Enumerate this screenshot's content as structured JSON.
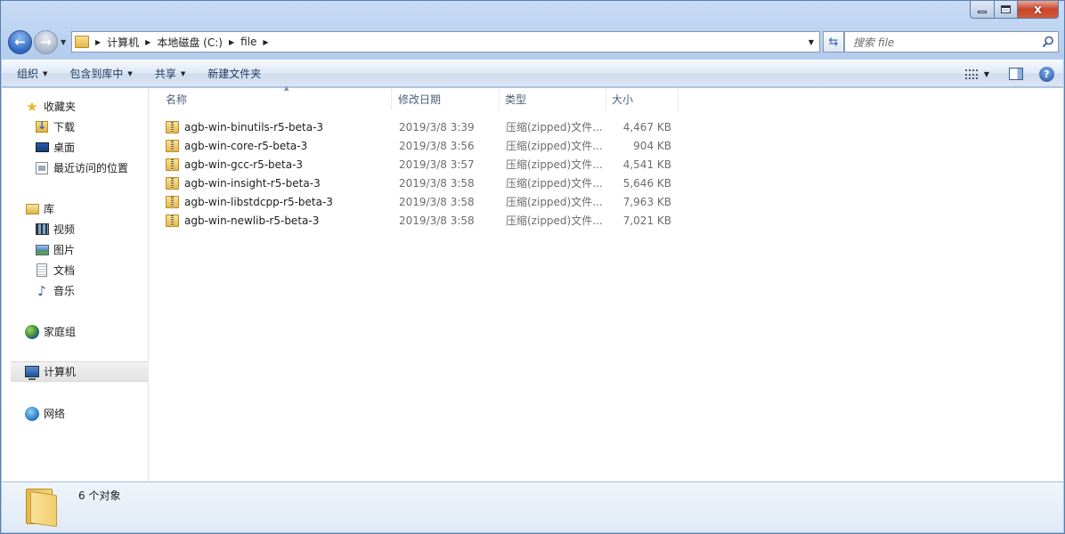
{
  "window": {
    "close_glyph": "x"
  },
  "address": {
    "crumbs": [
      "计算机",
      "本地磁盘 (C:)",
      "file"
    ]
  },
  "search": {
    "placeholder": "搜索 file"
  },
  "toolbar": {
    "organize": "组织",
    "include_in_library": "包含到库中",
    "share": "共享",
    "new_folder": "新建文件夹",
    "help": "?"
  },
  "sidebar": {
    "favorites": {
      "label": "收藏夹",
      "items": [
        {
          "label": "下载",
          "icon": "download-folder-icon"
        },
        {
          "label": "桌面",
          "icon": "desktop-icon"
        },
        {
          "label": "最近访问的位置",
          "icon": "recent-places-icon"
        }
      ]
    },
    "libraries": {
      "label": "库",
      "items": [
        {
          "label": "视频",
          "icon": "video-icon"
        },
        {
          "label": "图片",
          "icon": "pictures-icon"
        },
        {
          "label": "文档",
          "icon": "documents-icon"
        },
        {
          "label": "音乐",
          "icon": "music-icon"
        }
      ]
    },
    "homegroup": {
      "label": "家庭组"
    },
    "computer": {
      "label": "计算机"
    },
    "network": {
      "label": "网络"
    }
  },
  "columns": {
    "name": "名称",
    "modified": "修改日期",
    "type": "类型",
    "size": "大小"
  },
  "files": [
    {
      "name": "agb-win-binutils-r5-beta-3",
      "date": "2019/3/8 3:39",
      "type": "压缩(zipped)文件...",
      "size": "4,467 KB"
    },
    {
      "name": "agb-win-core-r5-beta-3",
      "date": "2019/3/8 3:56",
      "type": "压缩(zipped)文件...",
      "size": "904 KB"
    },
    {
      "name": "agb-win-gcc-r5-beta-3",
      "date": "2019/3/8 3:57",
      "type": "压缩(zipped)文件...",
      "size": "4,541 KB"
    },
    {
      "name": "agb-win-insight-r5-beta-3",
      "date": "2019/3/8 3:58",
      "type": "压缩(zipped)文件...",
      "size": "5,646 KB"
    },
    {
      "name": "agb-win-libstdcpp-r5-beta-3",
      "date": "2019/3/8 3:58",
      "type": "压缩(zipped)文件...",
      "size": "7,963 KB"
    },
    {
      "name": "agb-win-newlib-r5-beta-3",
      "date": "2019/3/8 3:58",
      "type": "压缩(zipped)文件...",
      "size": "7,021 KB"
    }
  ],
  "details": {
    "count": "6 个对象"
  }
}
